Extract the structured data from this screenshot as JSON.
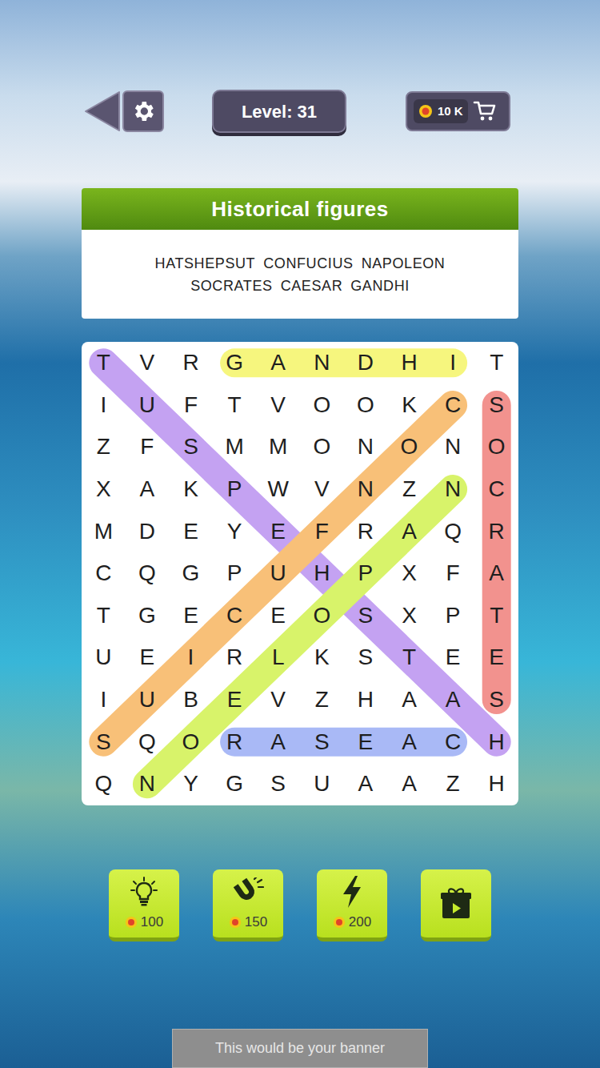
{
  "level": {
    "label": "Level: 31"
  },
  "coins": {
    "amount": "10 K"
  },
  "category": {
    "title": "Historical figures"
  },
  "words": [
    {
      "text": "HATSHEPSUT",
      "found": true,
      "color": "#c4a2f2",
      "start": [
        0,
        0
      ],
      "end": [
        9,
        9
      ]
    },
    {
      "text": "CONFUCIUS",
      "found": true,
      "color": "#f8c078",
      "start": [
        1,
        8
      ],
      "end": [
        9,
        0
      ]
    },
    {
      "text": "NAPOLEON",
      "found": true,
      "color": "#d8f36a",
      "start": [
        3,
        8
      ],
      "end": [
        10,
        1
      ]
    },
    {
      "text": "SOCRATES",
      "found": true,
      "color": "#f2928e",
      "start": [
        1,
        9
      ],
      "end": [
        8,
        9
      ]
    },
    {
      "text": "CAESAR",
      "found": true,
      "color": "#a9b9f6",
      "start": [
        9,
        8
      ],
      "end": [
        9,
        3
      ]
    },
    {
      "text": "GANDHI",
      "found": true,
      "color": "#f6f67e",
      "start": [
        0,
        3
      ],
      "end": [
        0,
        8
      ]
    }
  ],
  "grid": {
    "rows": [
      [
        "T",
        "V",
        "R",
        "G",
        "A",
        "N",
        "D",
        "H",
        "I",
        "T"
      ],
      [
        "I",
        "U",
        "F",
        "T",
        "V",
        "O",
        "O",
        "K",
        "C",
        "S"
      ],
      [
        "Z",
        "F",
        "S",
        "M",
        "M",
        "O",
        "N",
        "O",
        "N",
        "O"
      ],
      [
        "X",
        "A",
        "K",
        "P",
        "W",
        "V",
        "N",
        "Z",
        "N",
        "C"
      ],
      [
        "M",
        "D",
        "E",
        "Y",
        "E",
        "F",
        "R",
        "A",
        "Q",
        "R"
      ],
      [
        "C",
        "Q",
        "G",
        "P",
        "U",
        "H",
        "P",
        "X",
        "F",
        "A"
      ],
      [
        "T",
        "G",
        "E",
        "C",
        "E",
        "O",
        "S",
        "X",
        "P",
        "T"
      ],
      [
        "U",
        "E",
        "I",
        "R",
        "L",
        "K",
        "S",
        "T",
        "E",
        "E"
      ],
      [
        "I",
        "U",
        "B",
        "E",
        "V",
        "Z",
        "H",
        "A",
        "A",
        "S"
      ],
      [
        "S",
        "Q",
        "O",
        "R",
        "A",
        "S",
        "E",
        "A",
        "C",
        "H"
      ],
      [
        "Q",
        "N",
        "Y",
        "G",
        "S",
        "U",
        "A",
        "A",
        "Z",
        "H"
      ]
    ]
  },
  "tools": [
    {
      "kind": "hint",
      "price": "100"
    },
    {
      "kind": "magnet",
      "price": "150"
    },
    {
      "kind": "bolt",
      "price": "200"
    },
    {
      "kind": "video",
      "price": ""
    }
  ],
  "banner": {
    "text": "This would be your banner"
  }
}
